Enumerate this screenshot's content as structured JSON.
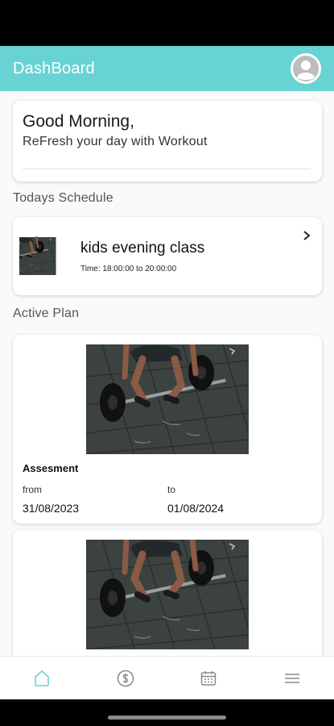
{
  "header": {
    "title": "DashBoard"
  },
  "greeting": {
    "title": "Good Morning,",
    "subtitle": "ReFresh your day with Workout"
  },
  "schedule": {
    "section_title": "Todays Schedule",
    "item": {
      "name": "kids evening class",
      "time": "Time: 18:00:00 to 20:00:00"
    }
  },
  "plans": {
    "section_title": "Active Plan",
    "items": [
      {
        "title": "Assesment",
        "from_label": "from",
        "to_label": "to",
        "from_date": "31/08/2023",
        "to_date": "01/08/2024"
      }
    ]
  },
  "nav": {
    "items": [
      "home-icon",
      "dollar-icon",
      "calendar-icon",
      "menu-icon"
    ],
    "active": "home-icon"
  },
  "colors": {
    "accent": "#67d3d3",
    "background": "#fafafa"
  }
}
